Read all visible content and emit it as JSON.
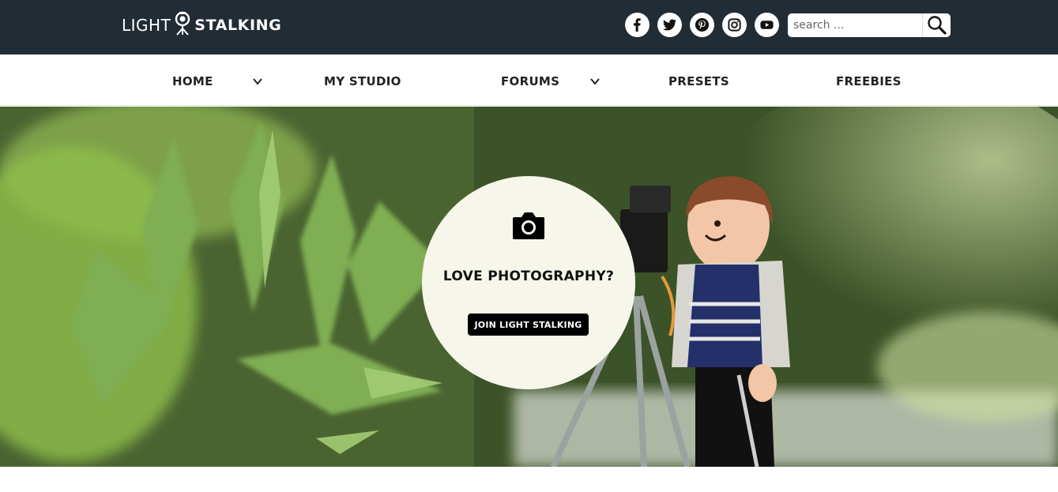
{
  "header": {
    "logo_light": "LIGHT",
    "logo_stalking": "STALKING",
    "socials": [
      {
        "name": "facebook-icon"
      },
      {
        "name": "twitter-icon"
      },
      {
        "name": "pinterest-icon"
      },
      {
        "name": "instagram-icon"
      },
      {
        "name": "youtube-icon"
      }
    ],
    "search": {
      "placeholder": "search ..."
    }
  },
  "nav": {
    "items": [
      {
        "label": "HOME",
        "has_dropdown": true
      },
      {
        "label": "MY STUDIO",
        "has_dropdown": false
      },
      {
        "label": "FORUMS",
        "has_dropdown": true
      },
      {
        "label": "PRESETS",
        "has_dropdown": false
      },
      {
        "label": "FREEBIES",
        "has_dropdown": false
      }
    ]
  },
  "hero": {
    "title": "LOVE PHOTOGRAPHY?",
    "button_label": "JOIN LIGHT STALKING",
    "icon": "camera-icon"
  },
  "colors": {
    "header_bg": "#222c35",
    "circle_bg": "#f6f6ea",
    "button_bg": "#000000"
  }
}
